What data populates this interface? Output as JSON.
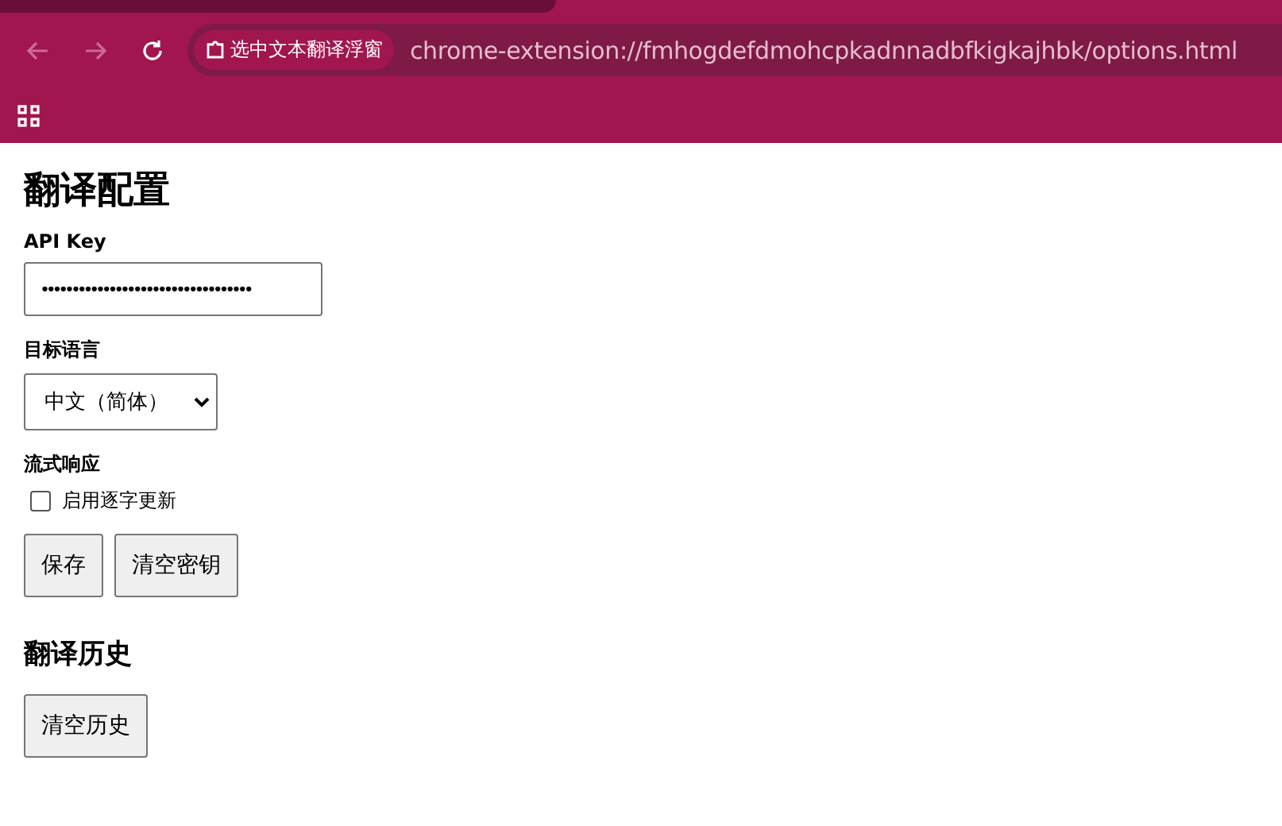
{
  "browser": {
    "site_chip": "选中文本翻译浮窗",
    "url": "chrome-extension://fmhogdefdmohcpkadnnadbfkigkajhbk/options.html"
  },
  "page": {
    "title": "翻译配置",
    "api_key": {
      "label": "API Key",
      "value": "••••••••••••••••••••••••••••••••••"
    },
    "language": {
      "label": "目标语言",
      "value": "中文（简体）"
    },
    "streaming": {
      "label": "流式响应",
      "option": "启用逐字更新",
      "checked": false
    },
    "buttons": [
      "保存",
      "清空密钥"
    ],
    "history": {
      "title": "翻译历史",
      "button": "清空历史"
    }
  }
}
